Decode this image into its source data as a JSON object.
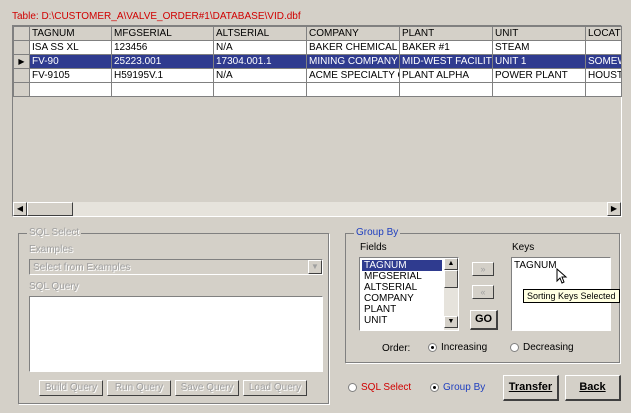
{
  "table": {
    "title": "Table: D:\\CUSTOMER_A\\VALVE_ORDER#1\\DATABASE\\VID.dbf",
    "columns": [
      "TAGNUM",
      "MFGSERIAL",
      "ALTSERIAL",
      "COMPANY",
      "PLANT",
      "UNIT",
      "LOCATI"
    ],
    "rows": [
      [
        "ISA SS XL",
        "123456",
        "N/A",
        "BAKER CHEMICAL",
        "BAKER #1",
        "STEAM",
        ""
      ],
      [
        "FV-90",
        "25223.001",
        "17304.001.1",
        "MINING COMPANY",
        "MID-WEST FACILIT",
        "UNIT 1",
        "SOMEW"
      ],
      [
        "FV-9105",
        "H59195V.1",
        "N/A",
        "ACME SPECIALTY C",
        "PLANT ALPHA",
        "POWER PLANT",
        "HOUST"
      ]
    ],
    "selected_row": 1
  },
  "sql_select": {
    "legend": "SQL Select",
    "examples_label": "Examples",
    "examples_value": "Select from Examples",
    "query_label": "SQL Query",
    "buttons": [
      "Build Query",
      "Run Query",
      "Save Query",
      "Load Query"
    ]
  },
  "group_by": {
    "legend": "Group By",
    "fields_label": "Fields",
    "fields": [
      "TAGNUM",
      "MFGSERIAL",
      "ALTSERIAL",
      "COMPANY",
      "PLANT",
      "UNIT"
    ],
    "selected_field": 0,
    "keys_label": "Keys",
    "keys": [
      "TAGNUM"
    ],
    "add_button": "»",
    "remove_button": "«",
    "go_button": "GO",
    "tooltip": "Sorting Keys Selected",
    "order_label": "Order:",
    "order_increasing": "Increasing",
    "order_decreasing": "Decreasing",
    "order_selected": "Increasing"
  },
  "mode": {
    "sql_select_label": "SQL Select",
    "group_by_label": "Group By",
    "selected": "Group By"
  },
  "actions": {
    "transfer": "Transfer",
    "back": "Back"
  },
  "colors": {
    "title": "#d00000",
    "selection": "#2f3b8f",
    "legend_blue": "#1f3fbf"
  }
}
